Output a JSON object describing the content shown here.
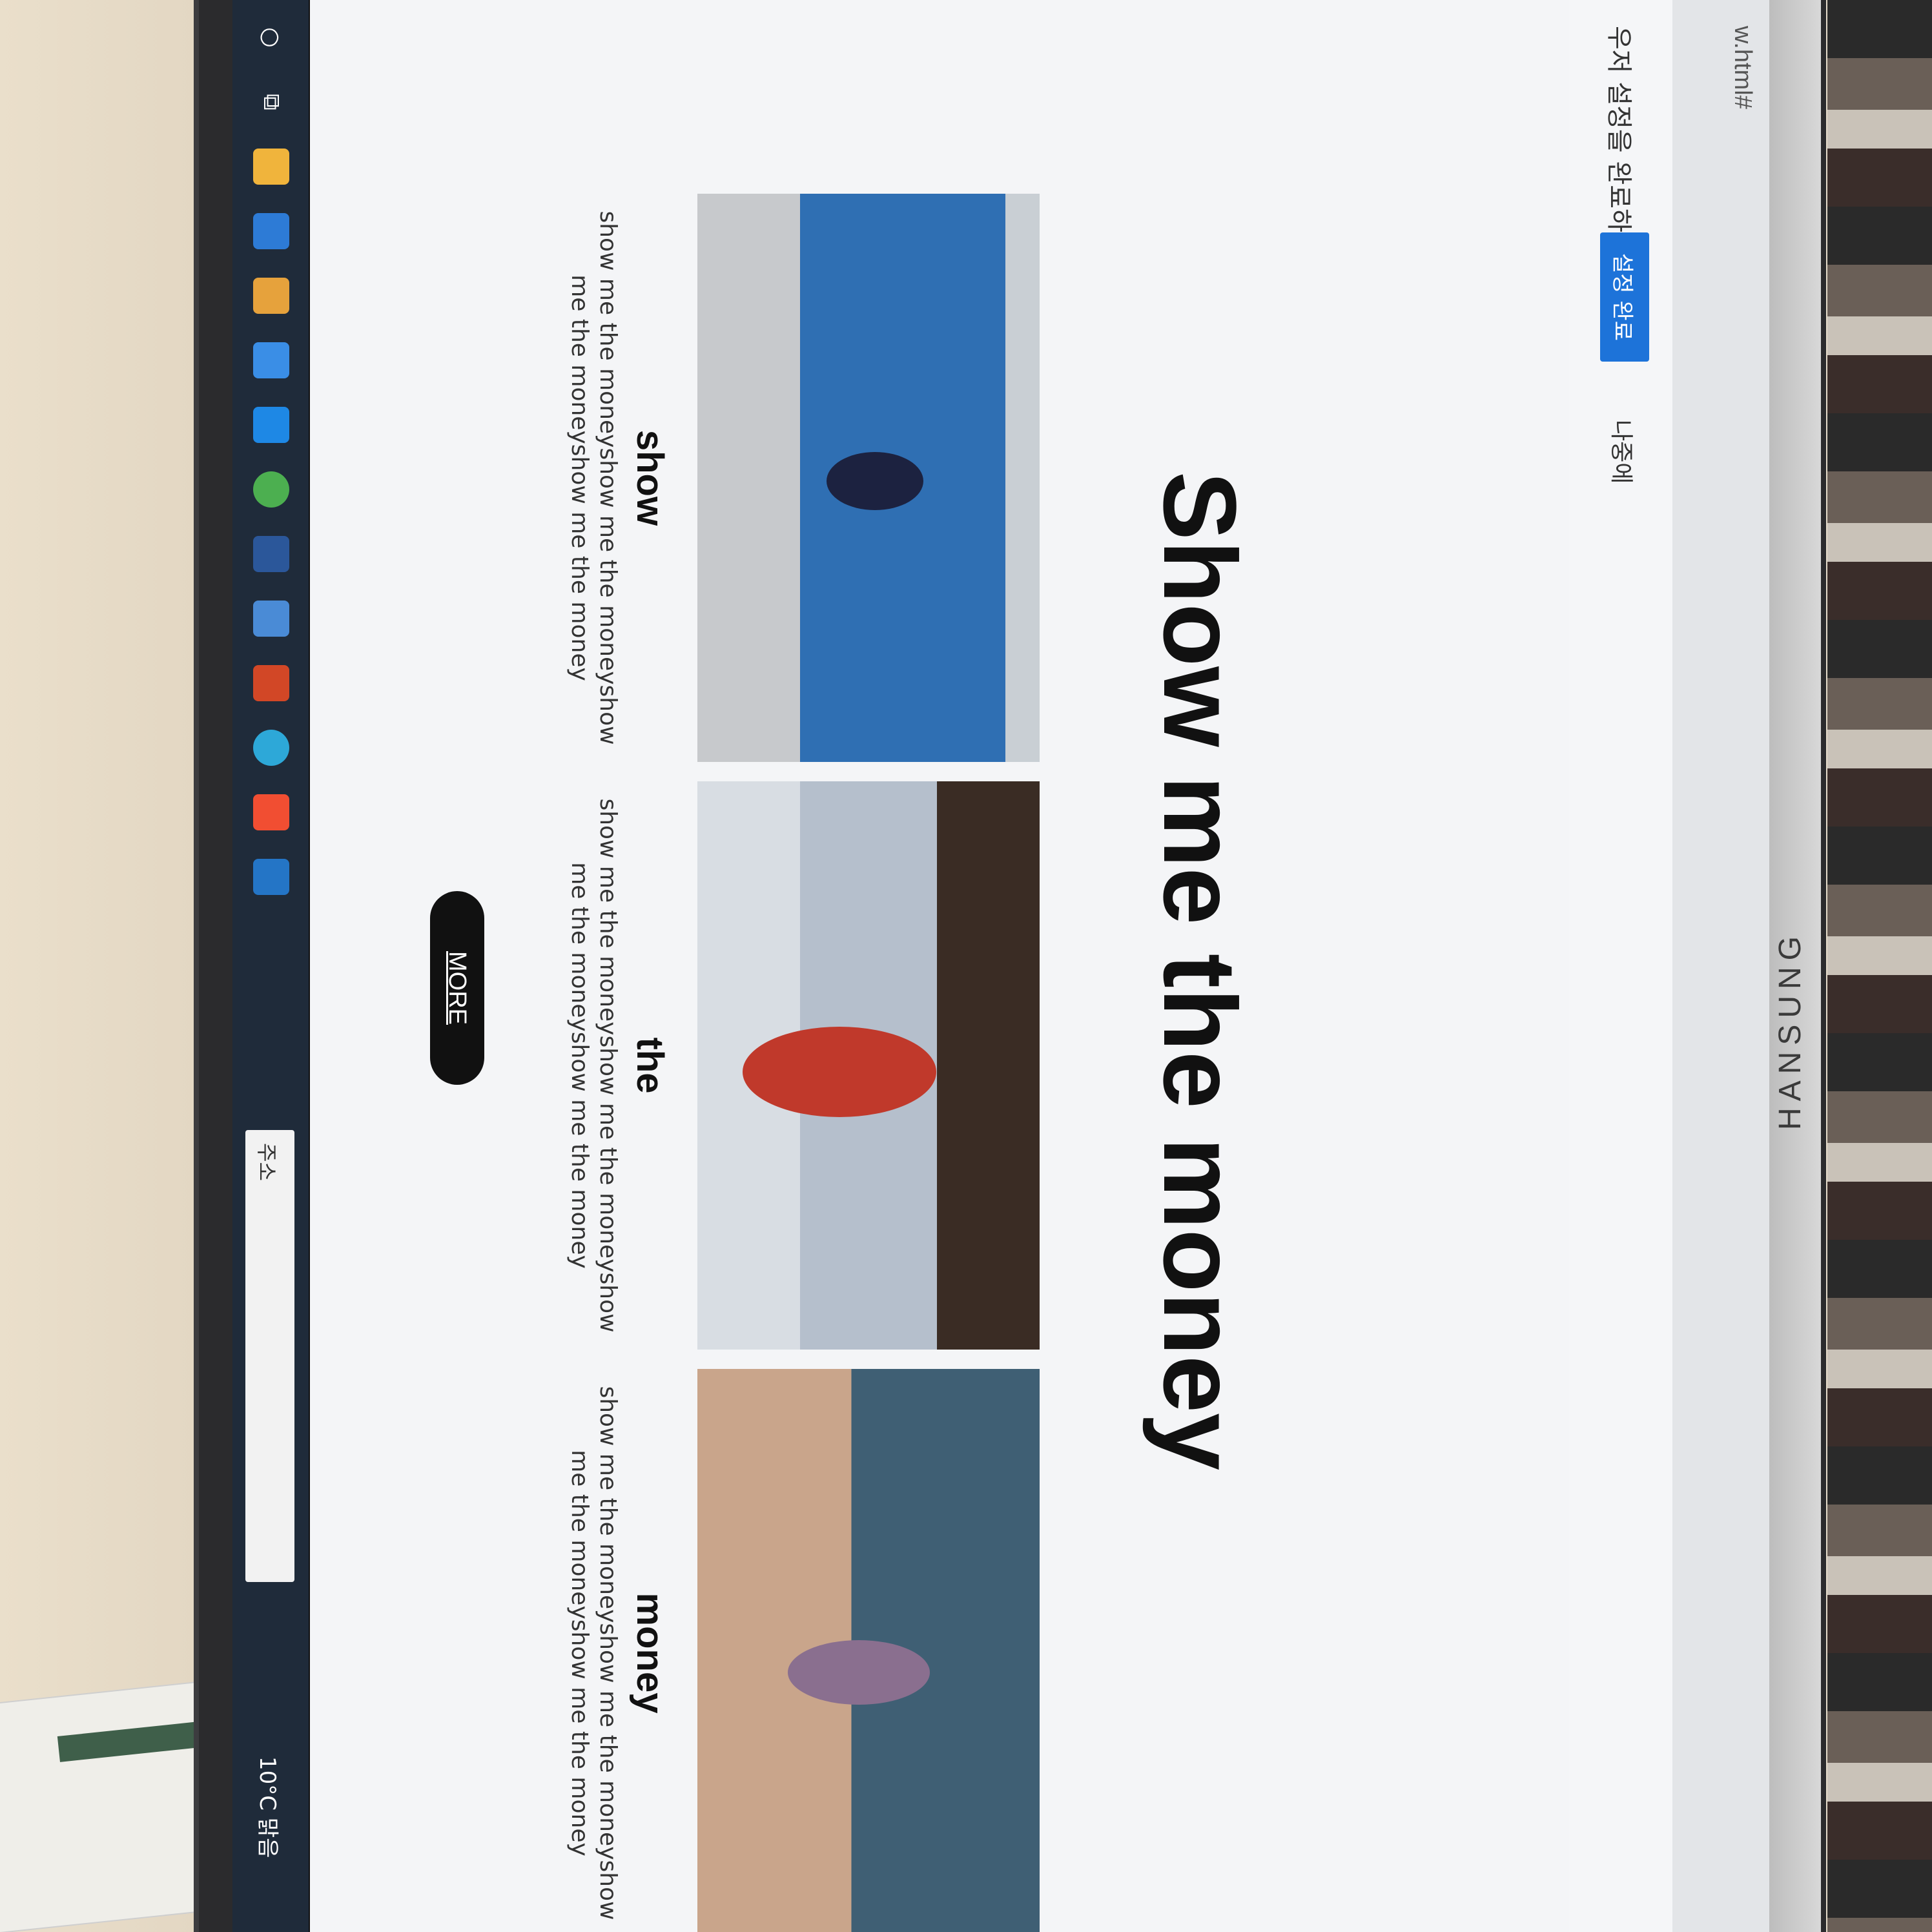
{
  "browser": {
    "address_fragment": "w.html#"
  },
  "notice": {
    "text": "우저 설정을 완료하세요.",
    "primary_button": "설정 완료",
    "later_link": "나중에"
  },
  "page": {
    "title": "Show me the money",
    "cards": [
      {
        "caption": "show",
        "body": "show me the moneyshow me the moneyshow me the moneyshow me the money"
      },
      {
        "caption": "the",
        "body": "show me the moneyshow me the moneyshow me the moneyshow me the money"
      },
      {
        "caption": "money",
        "body": "show me the moneyshow me the moneyshow me the moneyshow me the money"
      }
    ],
    "more_button": "MORE"
  },
  "taskbar": {
    "search_label": "주소",
    "weather": "10°C 맑음",
    "icons": [
      "search-icon",
      "task-view-icon",
      "file-explorer-icon",
      "store-icon",
      "edge-legacy-icon",
      "mail-icon",
      "chrome-icon",
      "word-icon",
      "app-icon",
      "powerpoint-icon",
      "edge-icon",
      "git-icon",
      "vscode-icon"
    ]
  },
  "monitor": {
    "brand": "HANSUNG"
  }
}
